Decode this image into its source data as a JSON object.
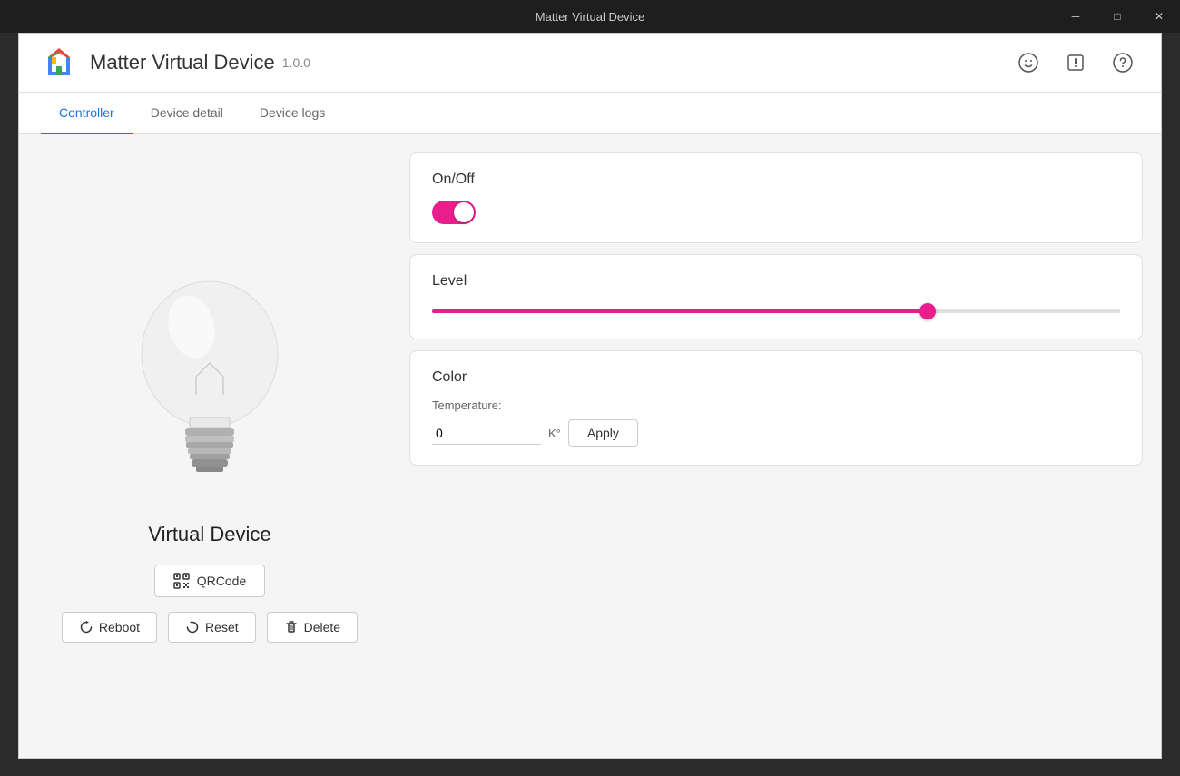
{
  "titlebar": {
    "title": "Matter Virtual Device",
    "minimize_label": "─",
    "restore_label": "□",
    "close_label": "✕"
  },
  "header": {
    "app_title": "Matter Virtual Device",
    "app_version": "1.0.0",
    "icons": {
      "feedback": "☺",
      "alert": "⚠",
      "help": "?"
    }
  },
  "tabs": [
    {
      "id": "controller",
      "label": "Controller",
      "active": true
    },
    {
      "id": "device-detail",
      "label": "Device detail",
      "active": false
    },
    {
      "id": "device-logs",
      "label": "Device logs",
      "active": false
    }
  ],
  "left_panel": {
    "device_name": "Virtual Device",
    "qrcode_btn_label": "QRCode",
    "reboot_btn_label": "Reboot",
    "reset_btn_label": "Reset",
    "delete_btn_label": "Delete"
  },
  "right_panel": {
    "on_off_card": {
      "title": "On/Off",
      "toggle_state": "on"
    },
    "level_card": {
      "title": "Level",
      "slider_value": 72
    },
    "color_card": {
      "title": "Color",
      "temperature_label": "Temperature:",
      "temperature_value": "0",
      "temperature_unit": "K°",
      "apply_label": "Apply"
    }
  }
}
